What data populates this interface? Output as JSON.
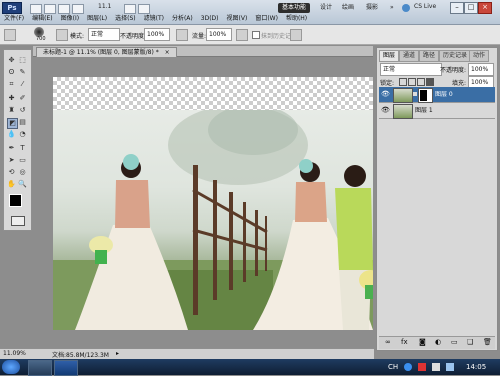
{
  "app": {
    "logo": "Ps",
    "zoom_display": "11.1",
    "workspaces": [
      "基本功能",
      "设计",
      "绘画",
      "摄影"
    ],
    "more": "»",
    "cs_live": "CS Live",
    "menu": [
      "文件(F)",
      "编辑(E)",
      "图像(I)",
      "图层(L)",
      "选择(S)",
      "滤镜(T)",
      "分析(A)",
      "3D(D)",
      "视图(V)",
      "窗口(W)",
      "帮助(H)"
    ]
  },
  "options": {
    "brush_size": "700",
    "mode_label": "模式:",
    "mode_value": "正常",
    "opacity_label": "不透明度:",
    "opacity_value": "100%",
    "flow_label": "流量:",
    "flow_value": "100%",
    "history_label": "抹到历史记录"
  },
  "document": {
    "tab_title": "未标题-1 @ 11.1% (图层 0, 图层蒙版/8) *",
    "close": "×",
    "zoom": "11.09%",
    "doc_info": "文档:85.8M/123.3M"
  },
  "layers": {
    "tabs": [
      "图层",
      "通道",
      "路径",
      "历史记录",
      "动作"
    ],
    "blend_mode": "正常",
    "opacity_label": "不透明度:",
    "opacity_value": "100%",
    "lock_label": "锁定:",
    "fill_label": "填充:",
    "fill_value": "100%",
    "items": [
      {
        "name": "图层 0",
        "selected": true
      },
      {
        "name": "图层 1",
        "selected": false
      }
    ]
  },
  "taskbar": {
    "time": "14:05",
    "lang": "CH"
  },
  "colors": {
    "accent": "#3a6ea5",
    "workspace_active": "#2d2d2d"
  }
}
